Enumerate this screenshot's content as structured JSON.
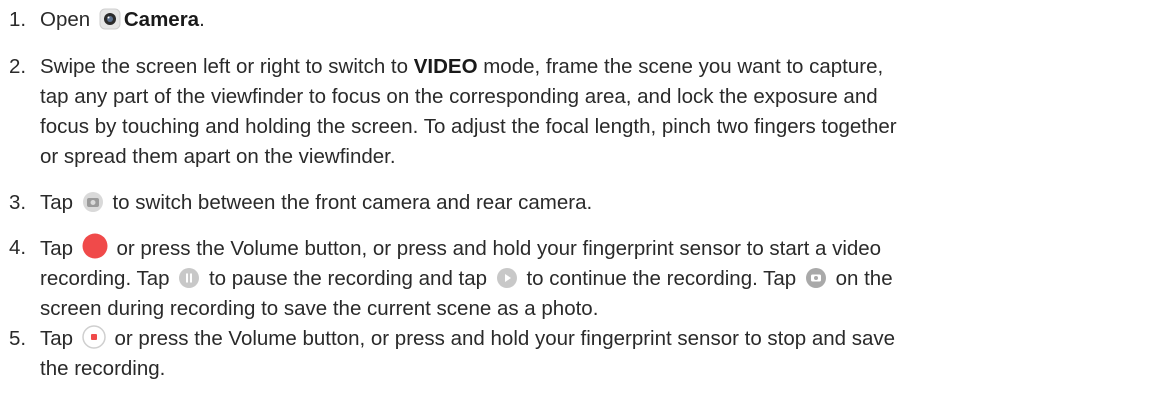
{
  "steps": [
    {
      "num": "1.",
      "open": "Open",
      "camera": "Camera",
      "period": "."
    },
    {
      "num": "2.",
      "l1a": "Swipe the screen left or right to switch to",
      "l1b": "VIDEO",
      "l1c": "mode, frame the scene you want to capture,",
      "l2": "tap any part of the viewfinder to focus on the corresponding area, and lock the exposure and",
      "l3": "focus by touching and holding the screen. To adjust the focal length, pinch two fingers together",
      "l4": "or spread them apart on the viewfinder."
    },
    {
      "num": "3.",
      "a": "Tap",
      "b": "to switch between the front camera and rear camera."
    },
    {
      "num": "4.",
      "l1a": "Tap",
      "l1b": "or press the Volume button, or press and hold your fingerprint sensor to start a video",
      "l2a": "recording. Tap",
      "l2b": "to pause the recording and tap",
      "l2c": "to continue the recording. Tap",
      "l2d": "on the",
      "l3": "screen during recording to save the current scene as a photo."
    },
    {
      "num": "5.",
      "l1a": "Tap",
      "l1b": "or press the Volume button, or press and hold your fingerprint sensor to stop and save",
      "l2": "the recording."
    }
  ],
  "icons": {
    "camera_app": "camera-app-icon",
    "switch_camera": "switch-camera-icon",
    "record": "record-icon",
    "pause": "pause-icon",
    "play": "play-icon",
    "snapshot": "snapshot-icon",
    "stop": "stop-icon"
  },
  "colors": {
    "record_red": "#f04a4a",
    "text": "#2a2a2a",
    "icon_grey": "#bdbdbd"
  }
}
